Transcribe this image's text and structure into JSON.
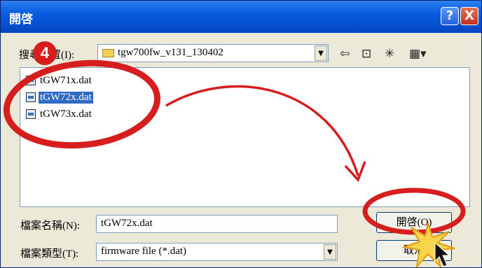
{
  "window": {
    "title": "開啓"
  },
  "titlebar_buttons": {
    "help": "?",
    "close": "X"
  },
  "look_in": {
    "label": "搜尋位置(I):",
    "value": "tgw700fw_v131_130402"
  },
  "files": [
    {
      "name": "tGW71x.dat",
      "selected": false
    },
    {
      "name": "tGW72x.dat",
      "selected": true
    },
    {
      "name": "tGW73x.dat",
      "selected": false
    }
  ],
  "filename": {
    "label": "檔案名稱(N):",
    "value": "tGW72x.dat"
  },
  "filetype": {
    "label": "檔案類型(T):",
    "value": "firmware file (*.dat)"
  },
  "buttons": {
    "open": "開啓(O)",
    "cancel": "取消"
  },
  "annotation": {
    "step": "4"
  },
  "colors": {
    "accent": "#d61e1e",
    "titlebar": "#0a5fe0",
    "selection": "#316ac5"
  }
}
